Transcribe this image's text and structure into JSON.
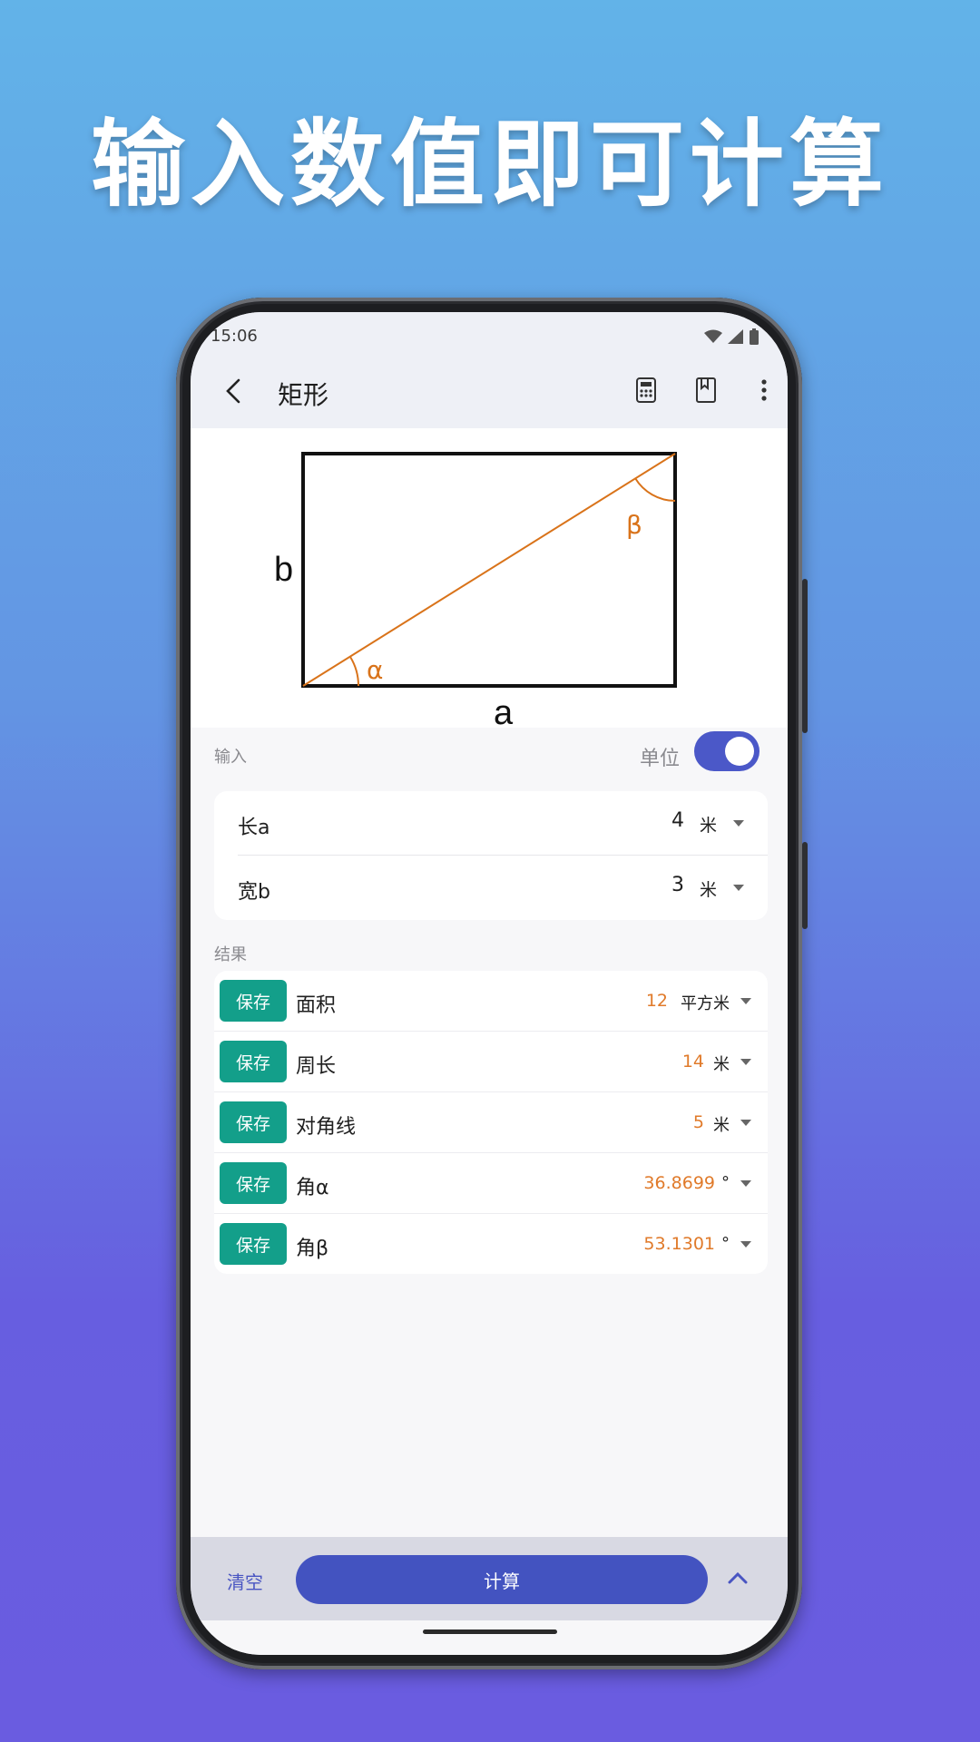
{
  "headline": "输入数值即可计算",
  "status_bar": {
    "time": "15:06"
  },
  "app_bar": {
    "title": "矩形",
    "icons": [
      "back-icon",
      "calculator-icon",
      "bookmark-icon",
      "more-vert-icon"
    ]
  },
  "figure": {
    "label_a": "a",
    "label_b": "b",
    "label_alpha": "α",
    "label_beta": "β"
  },
  "input_section": {
    "label": "输入",
    "unit_toggle_label": "单位",
    "unit_toggle_on": true,
    "rows": [
      {
        "label": "长a",
        "value": "4",
        "unit": "米"
      },
      {
        "label": "宽b",
        "value": "3",
        "unit": "米"
      }
    ]
  },
  "result_section": {
    "label": "结果",
    "save_label": "保存",
    "rows": [
      {
        "label": "面积",
        "value": "12",
        "unit": "平方米"
      },
      {
        "label": "周长",
        "value": "14",
        "unit": "米"
      },
      {
        "label": "对角线",
        "value": "5",
        "unit": "米"
      },
      {
        "label": "角α",
        "value": "36.8699",
        "unit": "°"
      },
      {
        "label": "角β",
        "value": "53.1301",
        "unit": "°"
      }
    ]
  },
  "bottom_bar": {
    "clear_label": "清空",
    "calculate_label": "计算"
  },
  "colors": {
    "accent": "#4353c0",
    "save_button": "#139f8a",
    "result_value": "#e07a2a",
    "figure_line": "#d9731a"
  }
}
